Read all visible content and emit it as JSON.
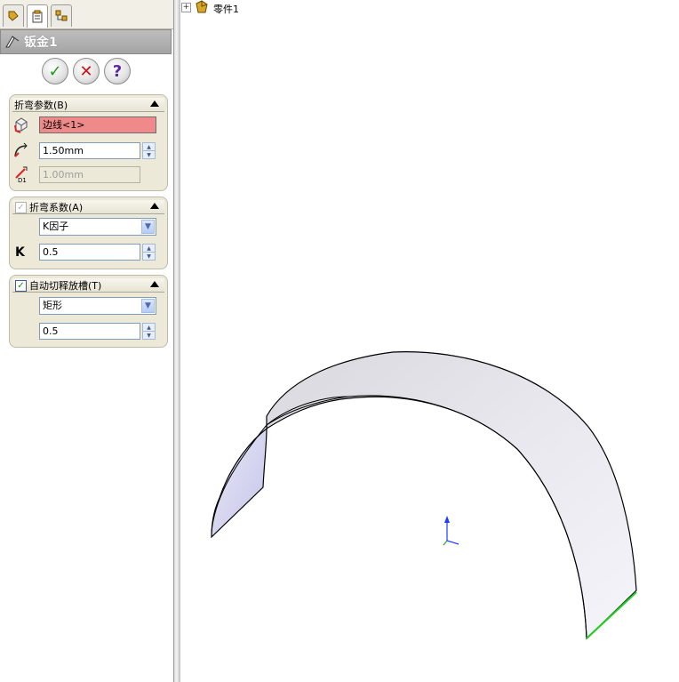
{
  "feature_title": "钣金1",
  "tree": {
    "root_label": "零件1",
    "expand_sign": "+"
  },
  "actions": {
    "ok_symbol": "✓",
    "cancel_symbol": "✕",
    "help_symbol": "?"
  },
  "bend_params": {
    "title": "折弯参数(B)",
    "edge_value": "边线<1>",
    "radius_value": "1.50mm",
    "thickness_value": "1.00mm"
  },
  "bend_allowance": {
    "title": "折弯系数(A)",
    "type_value": "K因子",
    "k_label": "K",
    "k_value": "0.5"
  },
  "auto_relief": {
    "title": "自动切释放槽(T)",
    "type_value": "矩形",
    "ratio_value": "0.5"
  },
  "colors": {
    "accent_green": "#22cc22",
    "selection_pink": "#f08a8a",
    "panel_bg": "#ece9d8"
  }
}
